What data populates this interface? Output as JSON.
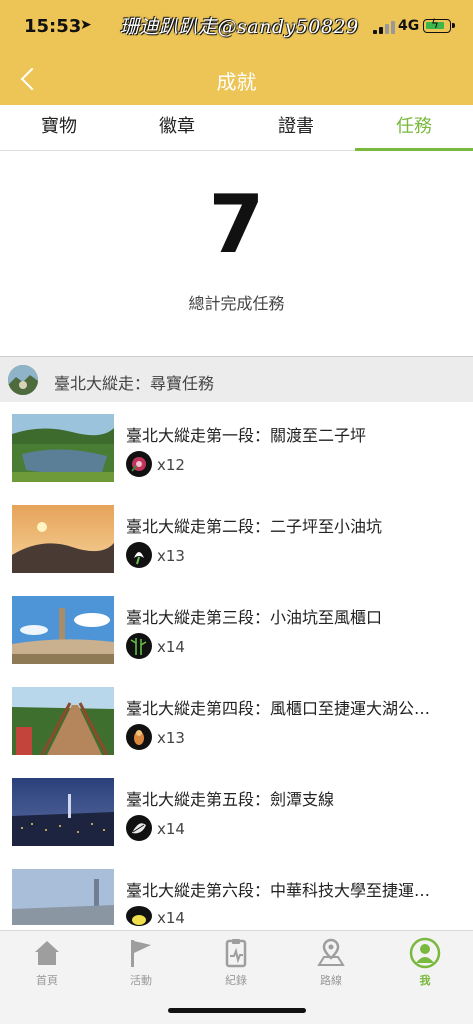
{
  "status_bar": {
    "time": "15:53",
    "network": "4G"
  },
  "watermark": "珊迪趴趴走@sandy50829",
  "header": {
    "title": "成就"
  },
  "tabs": [
    {
      "label": "寶物"
    },
    {
      "label": "徽章"
    },
    {
      "label": "證書"
    },
    {
      "label": "任務",
      "active": true
    }
  ],
  "summary": {
    "count": "7",
    "label": "總計完成任務"
  },
  "section": {
    "title": "臺北大縱走：尋寶任務"
  },
  "missions": [
    {
      "title": "臺北大縱走第一段：關渡至二子坪",
      "count": "x12",
      "badge_icon": "flower-icon"
    },
    {
      "title": "臺北大縱走第二段：二子坪至小油坑",
      "count": "x13",
      "badge_icon": "lily-icon"
    },
    {
      "title": "臺北大縱走第三段：小油坑至風櫃口",
      "count": "x14",
      "badge_icon": "bamboo-icon"
    },
    {
      "title": "臺北大縱走第四段：風櫃口至捷運大湖公…",
      "count": "x13",
      "badge_icon": "bird-icon"
    },
    {
      "title": "臺北大縱走第五段：劍潭支線",
      "count": "x14",
      "badge_icon": "leaf-icon"
    },
    {
      "title": "臺北大縱走第六段：中華科技大學至捷運…",
      "count": "x14",
      "badge_icon": "frog-icon"
    }
  ],
  "bottom_nav": [
    {
      "label": "首頁",
      "icon": "home-icon"
    },
    {
      "label": "活動",
      "icon": "flag-icon"
    },
    {
      "label": "紀錄",
      "icon": "record-icon"
    },
    {
      "label": "路線",
      "icon": "map-pin-icon"
    },
    {
      "label": "我",
      "icon": "person-icon",
      "active": true
    }
  ],
  "colors": {
    "header": "#ecc556",
    "accent": "#79b93d"
  }
}
